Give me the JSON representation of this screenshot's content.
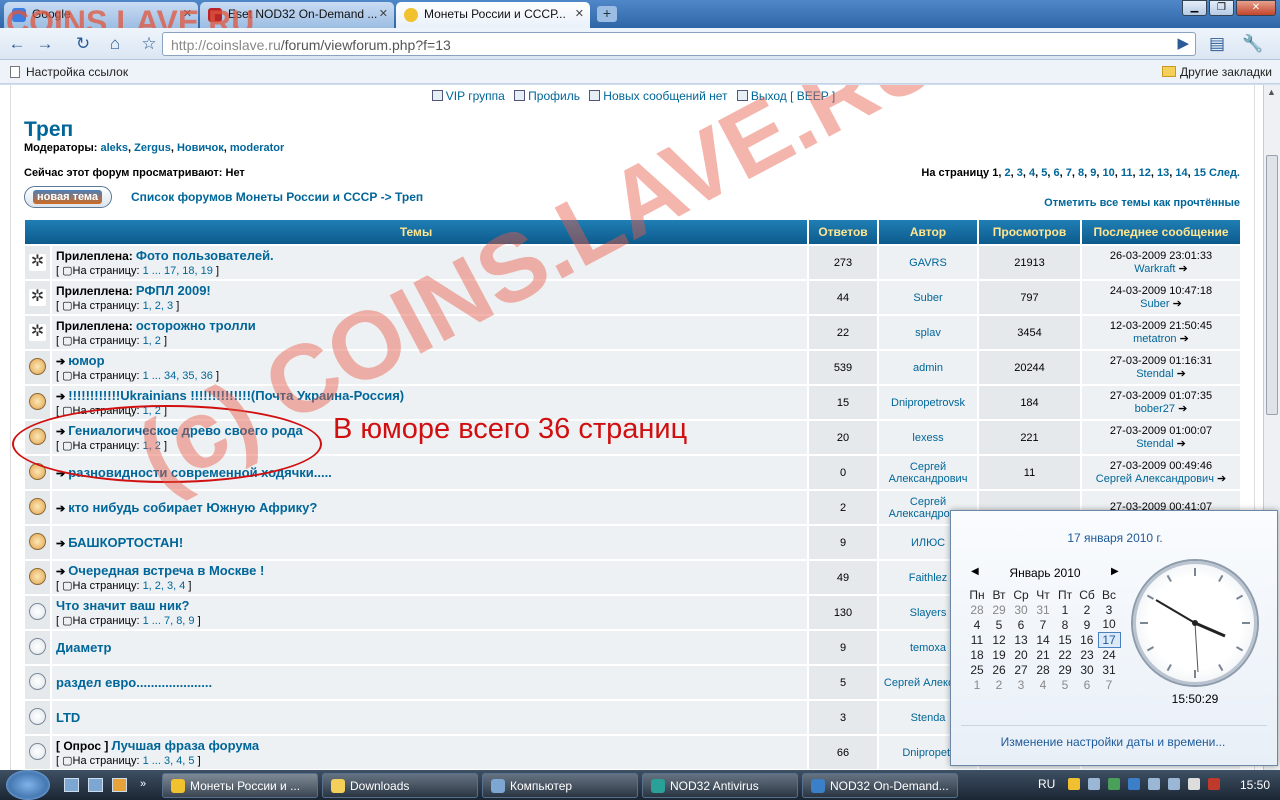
{
  "browser": {
    "tabs": [
      {
        "label": "Google",
        "color": "#3b7de0"
      },
      {
        "label": "Eset NOD32 On-Demand ...",
        "color": "#b8262b"
      },
      {
        "label": "Монеты России и СССР...",
        "color": "#f2c12e"
      }
    ],
    "new_tab": "+",
    "url_host": "http://coinslave.ru",
    "url_path": "/forum/viewforum.php?f=13",
    "bookmarks_left": "Настройка ссылок",
    "bookmarks_right": "Другие закладки"
  },
  "watermark": {
    "top_left": "COINS.LAVE.RU",
    "diagonal": "(c) COINS.LAVE.RU"
  },
  "forum": {
    "nav": {
      "vip": "VIP группа",
      "profile": "Профиль",
      "new_messages": "Новых сообщений нет",
      "logout": "Выход [ BEEP ]"
    },
    "title": "Треп",
    "moderators_label": "Модераторы:",
    "moderators": [
      "aleks",
      "Zergus",
      "Новичок",
      "moderator"
    ],
    "viewing": "Сейчас этот форум просматривают: Нет",
    "pager_label": "На страницу",
    "pager_current": "1",
    "pager_pages": [
      "2",
      "3",
      "4",
      "5",
      "6",
      "7",
      "8",
      "9",
      "10",
      "11",
      "12",
      "13",
      "14",
      "15"
    ],
    "pager_next": "След.",
    "new_topic": "новая тема",
    "breadcrumb": "Список форумов Монеты России и СССР -> Треп",
    "mark_read": "Отметить все темы как прочтённые",
    "columns": [
      "Темы",
      "Ответов",
      "Автор",
      "Просмотров",
      "Последнее сообщение"
    ],
    "rows": [
      {
        "icon": "sticky",
        "prefix": "Прилеплена:",
        "title": "Фото пользователей.",
        "pages": "1 ... 17, 18, 19",
        "replies": "273",
        "author": "GAVRS",
        "views": "21913",
        "last_date": "26-03-2009 23:01:33",
        "last_user": "Warkraft"
      },
      {
        "icon": "sticky",
        "prefix": "Прилеплена:",
        "title": "РФПЛ 2009!",
        "pages": "1, 2, 3",
        "replies": "44",
        "author": "Suber",
        "views": "797",
        "last_date": "24-03-2009 10:47:18",
        "last_user": "Suber"
      },
      {
        "icon": "sticky",
        "prefix": "Прилеплена:",
        "title": "осторожно тролли",
        "pages": "1, 2",
        "replies": "22",
        "author": "splav",
        "views": "3454",
        "last_date": "12-03-2009 21:50:45",
        "last_user": "metatron"
      },
      {
        "icon": "hot",
        "prefix": "",
        "title": "юмор",
        "pages": "1 ... 34, 35, 36",
        "replies": "539",
        "author": "admin",
        "views": "20244",
        "last_date": "27-03-2009 01:16:31",
        "last_user": "Stendal"
      },
      {
        "icon": "hot",
        "prefix": "",
        "title": "!!!!!!!!!!!!Ukrainians !!!!!!!!!!!!!!(Почта Украина-Россия)",
        "pages": "1, 2",
        "replies": "15",
        "author": "Dnipropetrovsk",
        "views": "184",
        "last_date": "27-03-2009 01:07:35",
        "last_user": "bober27"
      },
      {
        "icon": "hot",
        "prefix": "",
        "title": "Гениалогическое древо своего рода",
        "pages": "1, 2",
        "replies": "20",
        "author": "lexess",
        "views": "221",
        "last_date": "27-03-2009 01:00:07",
        "last_user": "Stendal"
      },
      {
        "icon": "hot",
        "prefix": "",
        "title": "разновидности современной ходячки.....",
        "pages": "",
        "replies": "0",
        "author": "Сергей Александрович",
        "views": "11",
        "last_date": "27-03-2009 00:49:46",
        "last_user": "Сергей Александрович"
      },
      {
        "icon": "hot",
        "prefix": "",
        "title": "кто нибудь собирает Южную Африку?",
        "pages": "",
        "replies": "2",
        "author": "Сергей Александрович",
        "views": "",
        "last_date": "27-03-2009 00:41:07",
        "last_user": ""
      },
      {
        "icon": "hot",
        "prefix": "",
        "title": "БАШКОРТОСТАН!",
        "pages": "",
        "replies": "9",
        "author": "ИЛЮС",
        "views": "",
        "last_date": "",
        "last_user": ""
      },
      {
        "icon": "hot",
        "prefix": "",
        "title": "Очередная встреча в Москве !",
        "pages": "1, 2, 3, 4",
        "replies": "49",
        "author": "Faithlez",
        "views": "",
        "last_date": "",
        "last_user": ""
      },
      {
        "icon": "plain",
        "prefix": "",
        "title": "Что значит ваш ник?",
        "pages": "1 ... 7, 8, 9",
        "replies": "130",
        "author": "Slayers",
        "views": "",
        "last_date": "",
        "last_user": ""
      },
      {
        "icon": "plain",
        "prefix": "",
        "title": "Диаметр",
        "pages": "",
        "replies": "9",
        "author": "temoxa",
        "views": "",
        "last_date": "",
        "last_user": ""
      },
      {
        "icon": "plain",
        "prefix": "",
        "title": "раздел евро.....................",
        "pages": "",
        "replies": "5",
        "author": "Сергей Александ",
        "views": "",
        "last_date": "",
        "last_user": ""
      },
      {
        "icon": "plain",
        "prefix": "",
        "title": "LTD",
        "pages": "",
        "replies": "3",
        "author": "Stenda",
        "views": "",
        "last_date": "",
        "last_user": ""
      },
      {
        "icon": "plain",
        "prefix": "[ Опрос ]",
        "title": "Лучшая фраза форума",
        "pages": "1 ... 3, 4, 5",
        "replies": "66",
        "author": "Dnipropetr",
        "views": "",
        "last_date": "",
        "last_user": ""
      }
    ],
    "pages_prefix": "На страницу:"
  },
  "annotation": "В юморе всего 36 страниц",
  "calendar": {
    "date_full": "17 января 2010 г.",
    "month": "Январь 2010",
    "weekdays": [
      "Пн",
      "Вт",
      "Ср",
      "Чт",
      "Пт",
      "Сб",
      "Вс"
    ],
    "weeks": [
      [
        "28",
        "29",
        "30",
        "31",
        "1",
        "2",
        "3"
      ],
      [
        "4",
        "5",
        "6",
        "7",
        "8",
        "9",
        "10"
      ],
      [
        "11",
        "12",
        "13",
        "14",
        "15",
        "16",
        "17"
      ],
      [
        "18",
        "19",
        "20",
        "21",
        "22",
        "23",
        "24"
      ],
      [
        "25",
        "26",
        "27",
        "28",
        "29",
        "30",
        "31"
      ],
      [
        "1",
        "2",
        "3",
        "4",
        "5",
        "6",
        "7"
      ]
    ],
    "today": "17",
    "time": "15:50:29",
    "settings_link": "Изменение настройки даты и времени..."
  },
  "taskbar": {
    "buttons": [
      {
        "label": "Монеты России и ...",
        "color": "#f2c12e"
      },
      {
        "label": "Downloads",
        "color": "#f4cf5a"
      },
      {
        "label": "Компьютер",
        "color": "#7ea6d2"
      },
      {
        "label": "NOD32 Antivirus",
        "color": "#2aa198"
      },
      {
        "label": "NOD32 On-Demand...",
        "color": "#3a7fc8"
      }
    ],
    "lang": "RU",
    "clock": "15:50"
  }
}
